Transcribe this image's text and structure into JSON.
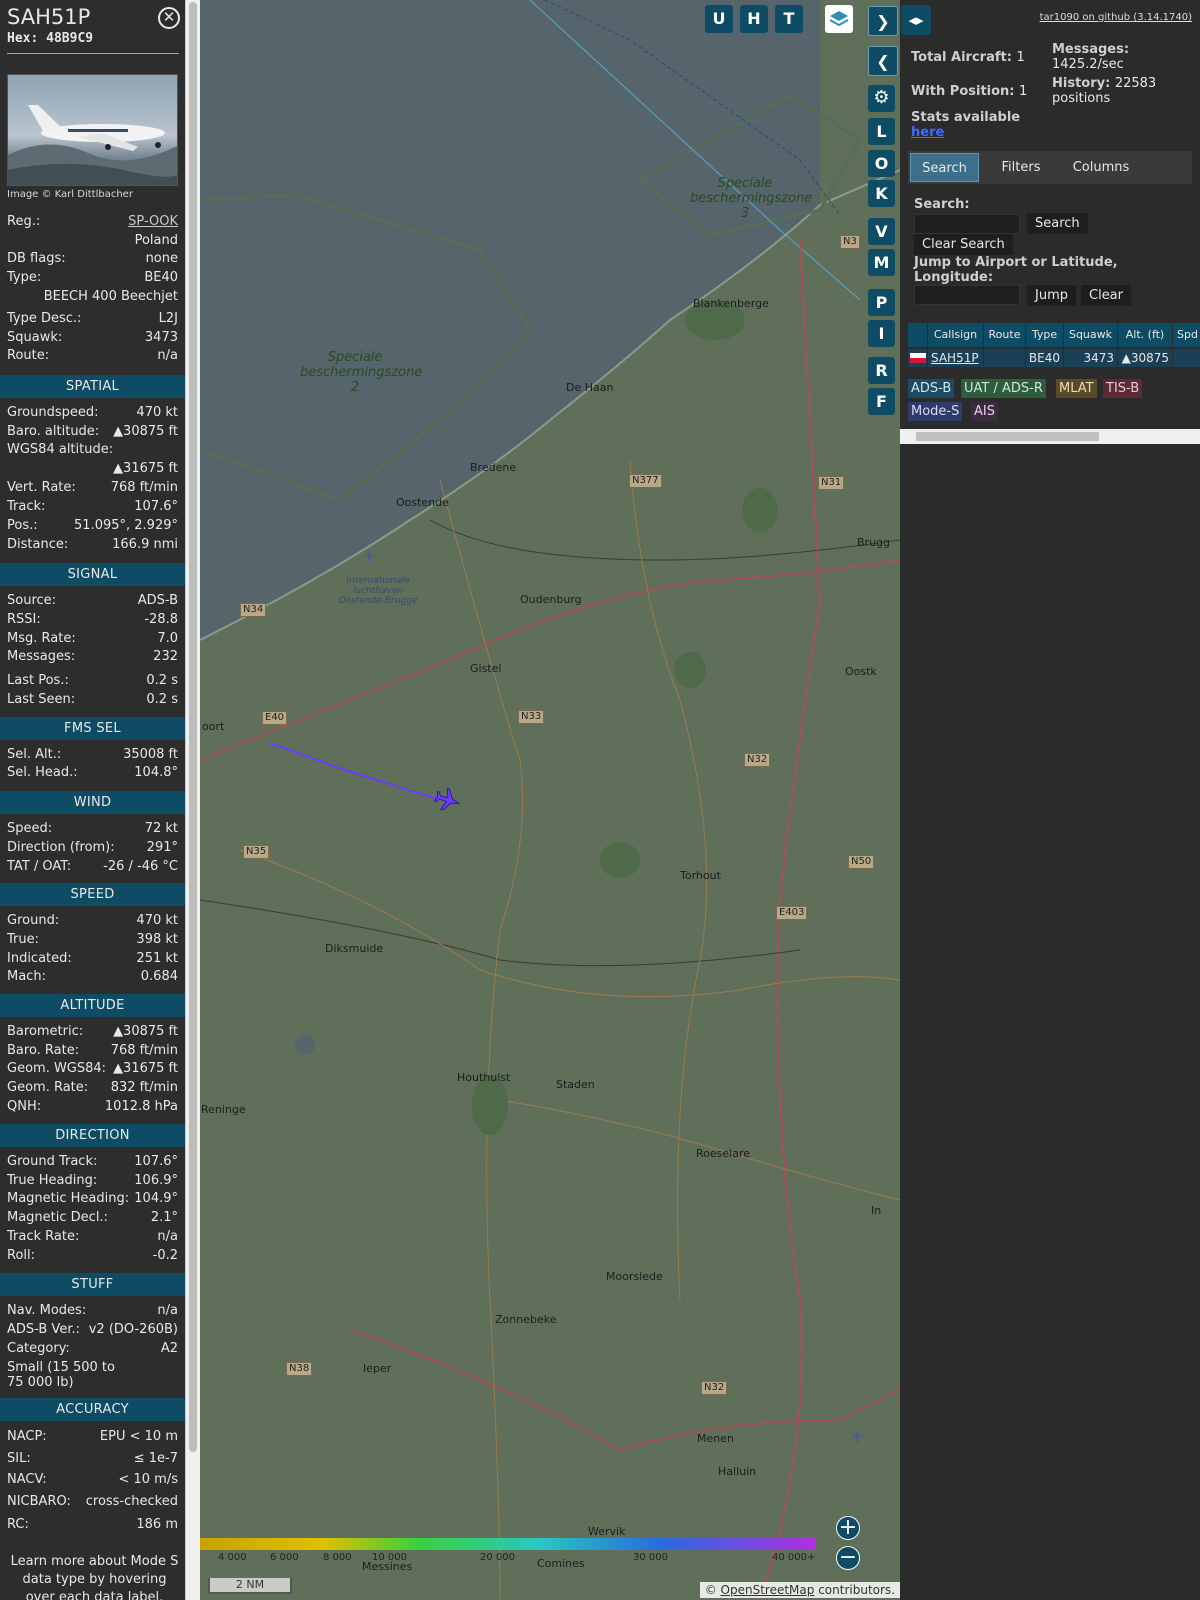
{
  "aircraft": {
    "callsign": "SAH51P",
    "hex_label": "Hex:",
    "hex": "48B9C9",
    "image_credit": "Image © Karl Dittlbacher",
    "basic": [
      {
        "key": "Reg.:",
        "value": "SP-OOK",
        "link": true
      },
      {
        "key": "",
        "value": "Poland"
      },
      {
        "key": "DB flags:",
        "value": "none"
      },
      {
        "key": "Type:",
        "value": "BE40"
      },
      {
        "key": "",
        "value": "BEECH 400 Beechjet"
      },
      {
        "key": "Type Desc.:",
        "value": "L2J"
      },
      {
        "key": "Squawk:",
        "value": "3473"
      },
      {
        "key": "Route:",
        "value": "n/a"
      }
    ]
  },
  "sections": {
    "spatial": {
      "title": "SPATIAL",
      "rows": [
        {
          "key": "Groundspeed:",
          "value": "470 kt"
        },
        {
          "key": "Baro. altitude:",
          "value": "▲30875 ft"
        },
        {
          "key": "WGS84 altitude:",
          "value": ""
        },
        {
          "key": "",
          "value": "▲31675 ft"
        },
        {
          "key": "Vert. Rate:",
          "value": "768 ft/min"
        },
        {
          "key": "Track:",
          "value": "107.6°"
        },
        {
          "key": "Pos.:",
          "value": "51.095°, 2.929°"
        },
        {
          "key": "Distance:",
          "value": "166.9 nmi"
        }
      ]
    },
    "signal": {
      "title": "SIGNAL",
      "rows": [
        {
          "key": "Source:",
          "value": "ADS-B"
        },
        {
          "key": "RSSI:",
          "value": "-28.8"
        },
        {
          "key": "Msg. Rate:",
          "value": "7.0"
        },
        {
          "key": "Messages:",
          "value": "232"
        },
        {
          "key": "Last Pos.:",
          "value": "0.2 s"
        },
        {
          "key": "Last Seen:",
          "value": "0.2 s"
        }
      ]
    },
    "fms": {
      "title": "FMS SEL",
      "rows": [
        {
          "key": "Sel. Alt.:",
          "value": "35008 ft"
        },
        {
          "key": "Sel. Head.:",
          "value": "104.8°"
        }
      ]
    },
    "wind": {
      "title": "WIND",
      "rows": [
        {
          "key": "Speed:",
          "value": "72 kt"
        },
        {
          "key": "Direction (from):",
          "value": "291°"
        },
        {
          "key": "TAT / OAT:",
          "value": "-26 / -46 °C"
        }
      ]
    },
    "speed": {
      "title": "SPEED",
      "rows": [
        {
          "key": "Ground:",
          "value": "470 kt"
        },
        {
          "key": "True:",
          "value": "398 kt"
        },
        {
          "key": "Indicated:",
          "value": "251 kt"
        },
        {
          "key": "Mach:",
          "value": "0.684"
        }
      ]
    },
    "altitude": {
      "title": "ALTITUDE",
      "rows": [
        {
          "key": "Barometric:",
          "value": "▲30875 ft"
        },
        {
          "key": "Baro. Rate:",
          "value": "768 ft/min"
        },
        {
          "key": "Geom. WGS84:",
          "value": "▲31675 ft"
        },
        {
          "key": "Geom. Rate:",
          "value": "832 ft/min"
        },
        {
          "key": "QNH:",
          "value": "1012.8 hPa"
        }
      ]
    },
    "direction": {
      "title": "DIRECTION",
      "rows": [
        {
          "key": "Ground Track:",
          "value": "107.6°"
        },
        {
          "key": "True Heading:",
          "value": "106.9°"
        },
        {
          "key": "Magnetic Heading:",
          "value": "104.9°"
        },
        {
          "key": "Magnetic Decl.:",
          "value": "2.1°"
        },
        {
          "key": "Track Rate:",
          "value": "n/a"
        },
        {
          "key": "Roll:",
          "value": "-0.2"
        }
      ]
    },
    "stuff": {
      "title": "STUFF",
      "rows": [
        {
          "key": "Nav. Modes:",
          "value": "n/a"
        },
        {
          "key": "ADS-B Ver.:",
          "value": "v2 (DO-260B)"
        },
        {
          "key": "Category:",
          "value": "A2"
        },
        {
          "key": "Small (15 500 to",
          "value": ""
        },
        {
          "key": "75 000 lb)",
          "value": ""
        }
      ]
    },
    "accuracy": {
      "title": "ACCURACY",
      "rows": [
        {
          "key": "NACP:",
          "value": "EPU < 10 m"
        },
        {
          "key": "SIL:",
          "value": "≤ 1e-7"
        },
        {
          "key": "NACV:",
          "value": "< 10 m/s"
        },
        {
          "key": "NICBARO:",
          "value": "cross-checked"
        },
        {
          "key": "RC:",
          "value": "186 m"
        }
      ],
      "footer_note": "Learn more about Mode S data type by hovering over each data label."
    }
  },
  "map": {
    "top_buttons": [
      "U",
      "H",
      "T"
    ],
    "side_buttons": [
      "L",
      "O",
      "K",
      "V",
      "M",
      "P",
      "I",
      "R",
      "F"
    ],
    "place_labels": [
      "Speciale beschermingszone 3",
      "Speciale beschermingszone 2",
      "Blankenberge",
      "De Haan",
      "Bredene",
      "Oostende",
      "Brugg",
      "Internationale luchthaven Oostende-Brugge",
      "Oudenburg",
      "Gistel",
      "Oostk",
      "oort",
      "Torhout",
      "Diksmuide",
      "Houthulst",
      "Staden",
      "Roeselare",
      "Reninge",
      "Moorslede",
      "Zonnebeke",
      "Ieper",
      "Menen",
      "Halluin",
      "Wervik",
      "Comines",
      "Messines",
      "In"
    ],
    "road_labels": [
      "N34",
      "N377",
      "N31",
      "N33",
      "N32",
      "N35",
      "N50",
      "E403",
      "N38",
      "N32",
      "E40",
      "N3"
    ],
    "altitude_scale": [
      "4 000",
      "6 000",
      "8 000",
      "10 000",
      "20 000",
      "30 000",
      "40 000+"
    ],
    "scale_bar": "2 NM",
    "attribution_prefix": "© ",
    "attribution_link": "OpenStreetMap",
    "attribution_suffix": " contributors."
  },
  "panel": {
    "version_link": "tar1090 on github (3.14.1740)",
    "total_aircraft_label": "Total Aircraft:",
    "total_aircraft": "1",
    "with_position_label": "With Position:",
    "with_position": "1",
    "messages_label": "Messages:",
    "messages_rate": "1425.2/sec",
    "history_label": "History:",
    "history_value": "22583",
    "history_unit": "positions",
    "stats_label": "Stats available",
    "stats_link": "here",
    "tabs": [
      "Search",
      "Filters",
      "Columns"
    ],
    "search_label": "Search:",
    "search_button": "Search",
    "clear_search_button": "Clear Search",
    "jump_label": "Jump to Airport or Latitude, Longitude:",
    "jump_button": "Jump",
    "clear_button": "Clear",
    "table_headers": [
      "",
      "Callsign",
      "Route",
      "Type",
      "Squawk",
      "Alt. (ft)",
      "Spd"
    ],
    "table_row": {
      "flag": "Poland",
      "callsign": "SAH51P",
      "route": "",
      "type": "BE40",
      "squawk": "3473",
      "alt": "▲30875",
      "spd": ""
    },
    "source_chips": [
      {
        "label": "ADS-B",
        "bg": "#1f4a63",
        "fg": "#cfe6f3"
      },
      {
        "label": "UAT / ADS-R",
        "bg": "#2e5c3c",
        "fg": "#cfe8d4"
      },
      {
        "label": "MLAT",
        "bg": "#5a4a2a",
        "fg": "#eddcb2"
      },
      {
        "label": "TIS-B",
        "bg": "#5c2a36",
        "fg": "#f0c9d0"
      },
      {
        "label": "Mode-S",
        "bg": "#2f3c6b",
        "fg": "#d3dcf6"
      },
      {
        "label": "AIS",
        "bg": "#3c2a40",
        "fg": "#e8d1ec"
      }
    ]
  },
  "colors": {
    "accent": "#0d4c64",
    "track": "#6a3dff",
    "water": "#56656c",
    "land": "#5f6f5a"
  }
}
